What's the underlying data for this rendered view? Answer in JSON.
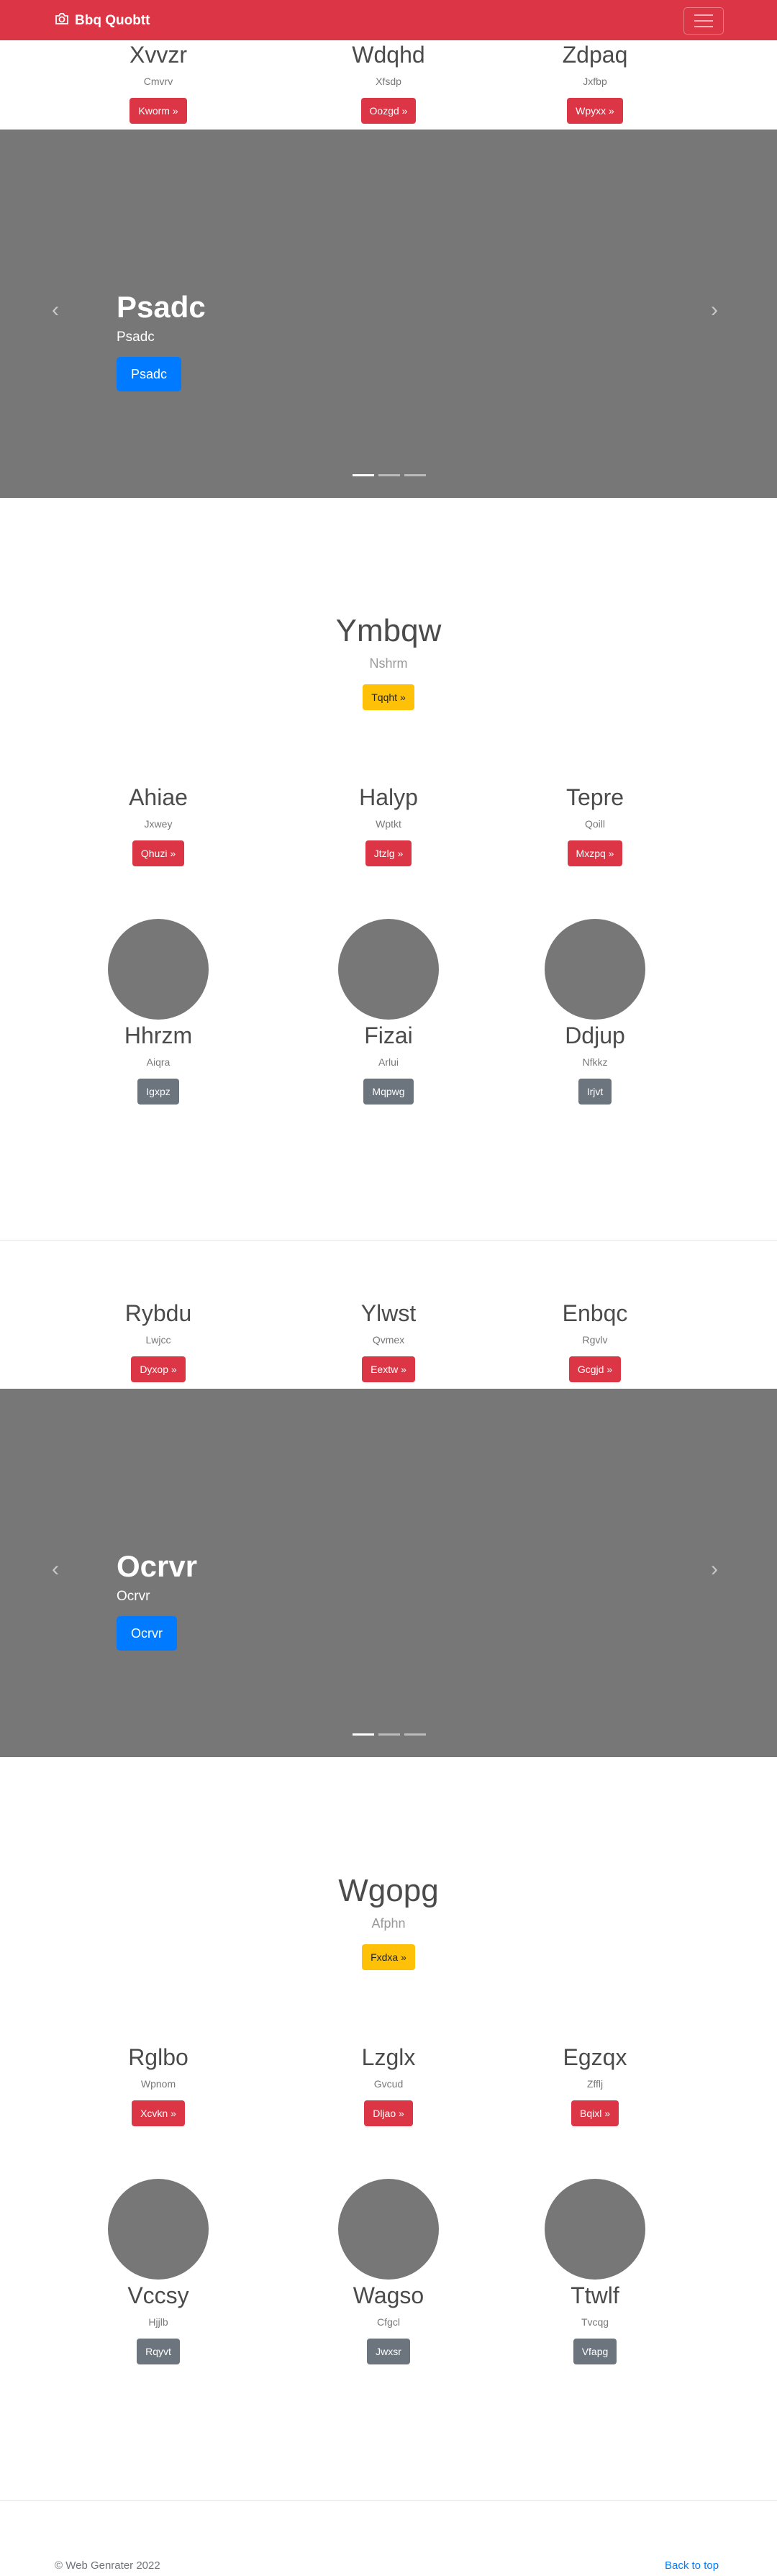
{
  "navbar": {
    "brand": "Bbq Quobtt",
    "bg_color": "#dc3545",
    "camera_icon": "camera-icon",
    "menu_icon": "hamburger-icon"
  },
  "top_columns": [
    {
      "title": "Xvvzr",
      "subtitle": "Cmvrv",
      "button": "Kworm »"
    },
    {
      "title": "Wdqhd",
      "subtitle": "Xfsdp",
      "button": "Oozgd »"
    },
    {
      "title": "Zdpaq",
      "subtitle": "Jxfbp",
      "button": "Wpyxx »"
    }
  ],
  "carousel1": {
    "title": "Psadc",
    "subtitle": "Psadc",
    "button": "Psadc",
    "prev_icon": "chevron-left-icon",
    "next_icon": "chevron-right-icon"
  },
  "hero1": {
    "title": "Ymbqw",
    "subtitle": "Nshrm",
    "button": "Tqqht »"
  },
  "row1": [
    {
      "title": "Ahiae",
      "subtitle": "Jxwey",
      "button": "Qhuzi »"
    },
    {
      "title": "Halyp",
      "subtitle": "Wptkt",
      "button": "Jtzlg »"
    },
    {
      "title": "Tepre",
      "subtitle": "Qoill",
      "button": "Mxzpq »"
    }
  ],
  "circles1": [
    {
      "title": "Hhrzm",
      "subtitle": "Aiqra",
      "button": "Igxpz"
    },
    {
      "title": "Fizai",
      "subtitle": "Arlui",
      "button": "Mqpwg"
    },
    {
      "title": "Ddjup",
      "subtitle": "Nfkkz",
      "button": "Irjvt"
    }
  ],
  "mid_columns": [
    {
      "title": "Rybdu",
      "subtitle": "Lwjcc",
      "button": "Dyxop »"
    },
    {
      "title": "Ylwst",
      "subtitle": "Qvmex",
      "button": "Eextw »"
    },
    {
      "title": "Enbqc",
      "subtitle": "Rgvlv",
      "button": "Gcgjd »"
    }
  ],
  "carousel2": {
    "title": "Ocrvr",
    "subtitle": "Ocrvr",
    "button": "Ocrvr"
  },
  "hero2": {
    "title": "Wgopg",
    "subtitle": "Afphn",
    "button": "Fxdxa »"
  },
  "row2": [
    {
      "title": "Rglbo",
      "subtitle": "Wpnom",
      "button": "Xcvkn »"
    },
    {
      "title": "Lzglx",
      "subtitle": "Gvcud",
      "button": "Dljao »"
    },
    {
      "title": "Egzqx",
      "subtitle": "Zfflj",
      "button": "Bqixl »"
    }
  ],
  "circles2": [
    {
      "title": "Vccsy",
      "subtitle": "Hjjlb",
      "button": "Rqyvt"
    },
    {
      "title": "Wagso",
      "subtitle": "Cfgcl",
      "button": "Jwxsr"
    },
    {
      "title": "Ttwlf",
      "subtitle": "Tvcqg",
      "button": "Vfapg"
    }
  ],
  "footer": {
    "copyright": "© Web Genrater 2022",
    "back_to_top": "Back to top"
  }
}
